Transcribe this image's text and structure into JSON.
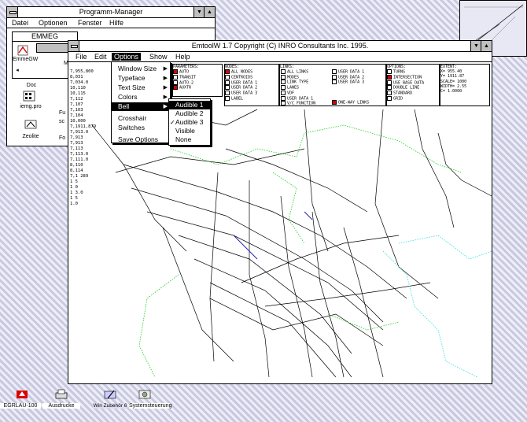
{
  "program_manager": {
    "title": "Programm-Manager",
    "menu": [
      "Datei",
      "Optionen",
      "Fenster",
      "Hilfe"
    ],
    "group_title": "EMMEG",
    "icons": [
      {
        "label": "EmmeGW",
        "icon": "emme-icon"
      },
      {
        "label": "Doc",
        "icon": "doc-icon"
      },
      {
        "label": "iemg.pro",
        "icon": "project-icon"
      },
      {
        "label": "Zeolite",
        "icon": "zeolite-icon"
      }
    ],
    "behind_fragments": [
      "M",
      "Ma",
      "Fu",
      "sc",
      "Fo"
    ]
  },
  "main_window": {
    "title": "EmtoolW 1.7  Copyright (C) INRO Consultants Inc. 1995.",
    "menu": [
      "File",
      "Edit",
      "Options",
      "Show",
      "Help"
    ],
    "options_menu": [
      {
        "label": "Window Size",
        "submenu": true
      },
      {
        "label": "Typeface",
        "submenu": true
      },
      {
        "label": "Text Size",
        "submenu": true
      },
      {
        "label": "Colors",
        "submenu": true
      },
      {
        "label": "Bell",
        "submenu": true,
        "selected": true
      },
      {
        "label": "Crosshair",
        "submenu": false
      },
      {
        "label": "Switches",
        "submenu": false
      },
      {
        "label": "Save Options",
        "submenu": false
      }
    ],
    "bell_submenu": [
      {
        "label": "Audible 1",
        "checked": false,
        "selected": true
      },
      {
        "label": "Audible 2",
        "checked": false
      },
      {
        "label": "Audible 3",
        "checked": true
      },
      {
        "label": "Visible",
        "checked": false
      },
      {
        "label": "None",
        "checked": false
      }
    ],
    "legend": [
      {
        "header": "PARAMETERS:",
        "items": [
          {
            "t": "AUTO",
            "red": true
          },
          {
            "t": "TRANSIT",
            "red": false
          },
          {
            "t": "AUTO-2",
            "red": false
          },
          {
            "t": "AUXTR",
            "red": false
          }
        ]
      },
      {
        "header": "NODES:",
        "items": [
          {
            "t": "ALL NODES",
            "red": true
          },
          {
            "t": "CENTROIDS",
            "red": false
          },
          {
            "t": "USER DATA 1",
            "red": false
          },
          {
            "t": "USER DATA 2",
            "red": false
          },
          {
            "t": "USER DATA 3",
            "red": false
          },
          {
            "t": "LABEL",
            "red": false
          }
        ]
      },
      {
        "header": "LINKS:",
        "items": [
          {
            "t": "ALL LINKS",
            "red": false
          },
          {
            "t": "MODES",
            "red": false
          },
          {
            "t": "LINK TYPE",
            "red": false
          },
          {
            "t": "LANES",
            "red": false
          },
          {
            "t": "VDF",
            "red": false
          },
          {
            "t": "USER DATA 1",
            "red": false
          },
          {
            "t": "V/C FUNCTION",
            "red": false
          }
        ]
      },
      {
        "header": "",
        "items": [
          {
            "t": "USER DATA 1",
            "red": false
          },
          {
            "t": "USER DATA 2",
            "red": false
          },
          {
            "t": "USER DATA 3",
            "red": false
          },
          {
            "t": "",
            "red": false
          },
          {
            "t": "",
            "red": false
          },
          {
            "t": "",
            "red": false
          },
          {
            "t": "ONE-WAY LINKS",
            "red": true
          }
        ]
      },
      {
        "header": "OPTIONS:",
        "items": [
          {
            "t": "TURNS",
            "red": false
          },
          {
            "t": "INTERSECTION",
            "red": true
          },
          {
            "t": "USE BASE DATA",
            "red": false
          },
          {
            "t": "DOUBLE LINE",
            "red": false
          },
          {
            "t": "STANDARD",
            "red": false
          },
          {
            "t": "GRID",
            "red": false
          }
        ]
      },
      {
        "header": "EXTENT:",
        "items": [
          {
            "t": "X=  955.40",
            "red": false
          },
          {
            "t": "Y= 1911.87",
            "red": false
          },
          {
            "t": "SCALE= 1000",
            "red": false
          },
          {
            "t": "WIDTH=  2.55",
            "red": false
          },
          {
            "t": "C=  1.0000",
            "red": false
          }
        ]
      }
    ],
    "left_numbers": [
      "7,955,800",
      "8,031",
      "7,034.0",
      "10,110",
      "10,115",
      "7,112",
      "7,107",
      "7,103",
      "7,104",
      "10,000",
      "7,1911,879",
      "7,913.0",
      "7,913",
      "7,913",
      "7,113",
      "7,113.0",
      "7,111.0",
      "8,110",
      "8,114",
      "7,1 289",
      "1 5",
      "1 0",
      "1 3.0",
      "1 5",
      "1.0"
    ]
  },
  "taskbar": [
    {
      "label": "EGRLAU-100",
      "icon": "flag-icon"
    },
    {
      "label": "Ausdrucke",
      "icon": "printer-icon"
    },
    {
      "label": "Win Zubehör 6",
      "icon": "pen-icon"
    },
    {
      "label": "Systemsteuerung",
      "icon": "control-panel-icon"
    }
  ],
  "colors": {
    "accent_red": "#dd0000",
    "network_green": "#22cc22",
    "network_cyan": "#33dddd",
    "highlight_black": "#000000"
  }
}
